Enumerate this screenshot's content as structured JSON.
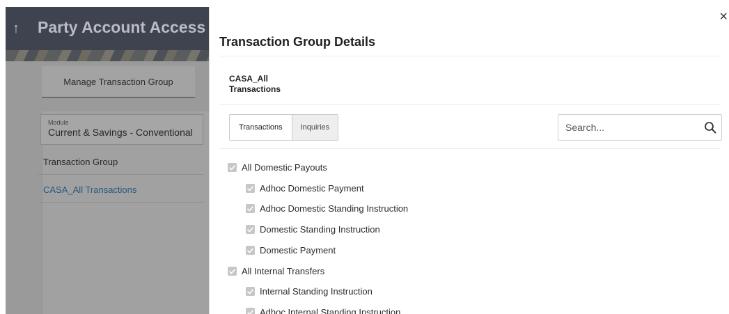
{
  "background": {
    "back_icon": "arrow-up-icon",
    "title": "Party Account Access",
    "tab_label": "Manage Transaction Group",
    "module_label": "Module",
    "module_value": "Current & Savings - Conventional",
    "group_column_header": "Transaction Group",
    "group_row_value": "CASA_All Transactions"
  },
  "drawer": {
    "close_icon": "close-icon",
    "close_glyph": "×",
    "title": "Transaction Group Details",
    "group_name_line1": "CASA_All",
    "group_name_line2": "Transactions",
    "tabs": [
      {
        "label": "Transactions",
        "active": true
      },
      {
        "label": "Inquiries",
        "active": false
      }
    ],
    "search": {
      "placeholder": "Search...",
      "value": "",
      "icon": "search-icon"
    },
    "tree": [
      {
        "label": "All Domestic Payouts",
        "level": 0,
        "checked": true
      },
      {
        "label": "Adhoc Domestic Payment",
        "level": 1,
        "checked": true
      },
      {
        "label": "Adhoc Domestic Standing Instruction",
        "level": 1,
        "checked": true
      },
      {
        "label": "Domestic Standing Instruction",
        "level": 1,
        "checked": true
      },
      {
        "label": "Domestic Payment",
        "level": 1,
        "checked": true
      },
      {
        "label": "All Internal Transfers",
        "level": 0,
        "checked": true
      },
      {
        "label": "Internal Standing Instruction",
        "level": 1,
        "checked": true
      },
      {
        "label": "Adhoc Internal Standing Instruction",
        "level": 1,
        "checked": true
      }
    ]
  },
  "colors": {
    "header_bg": "#3f4350",
    "overlay_gray": "#9a9a9a",
    "link": "#2a5a7d",
    "checkbox_gray": "#c7c7c7"
  }
}
